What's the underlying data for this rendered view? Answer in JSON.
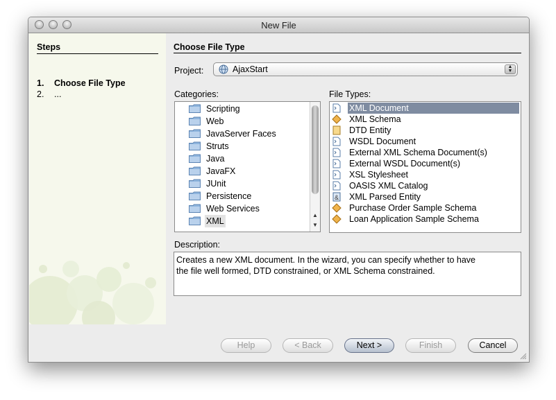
{
  "window": {
    "title": "New File"
  },
  "steps": {
    "header": "Steps",
    "items": [
      {
        "num": "1.",
        "label": "Choose File Type"
      },
      {
        "num": "2.",
        "label": "..."
      }
    ]
  },
  "main": {
    "title": "Choose File Type",
    "project_label": "Project:",
    "project_value": "AjaxStart",
    "categories_label": "Categories:",
    "file_types_label": "File Types:",
    "description_label": "Description:",
    "description_line1": "Creates a new XML document. In the wizard, you can specify whether to have",
    "description_line2": "the file well formed, DTD constrained, or XML Schema constrained."
  },
  "categories": [
    {
      "label": "Scripting"
    },
    {
      "label": "Web"
    },
    {
      "label": "JavaServer Faces"
    },
    {
      "label": "Struts"
    },
    {
      "label": "Java"
    },
    {
      "label": "JavaFX"
    },
    {
      "label": "JUnit"
    },
    {
      "label": "Persistence"
    },
    {
      "label": "Web Services"
    },
    {
      "label": "XML"
    }
  ],
  "file_types": [
    {
      "label": "XML Document",
      "icon": "xml-document-icon"
    },
    {
      "label": "XML Schema",
      "icon": "xml-schema-icon"
    },
    {
      "label": "DTD Entity",
      "icon": "dtd-entity-icon"
    },
    {
      "label": "WSDL Document",
      "icon": "wsdl-document-icon"
    },
    {
      "label": "External XML Schema Document(s)",
      "icon": "document-icon"
    },
    {
      "label": "External WSDL Document(s)",
      "icon": "document-icon"
    },
    {
      "label": "XSL Stylesheet",
      "icon": "xsl-stylesheet-icon"
    },
    {
      "label": "OASIS XML Catalog",
      "icon": "document-icon"
    },
    {
      "label": "XML Parsed Entity",
      "icon": "parsed-entity-icon"
    },
    {
      "label": "Purchase Order Sample Schema",
      "icon": "xml-schema-icon"
    },
    {
      "label": "Loan Application Sample Schema",
      "icon": "xml-schema-icon"
    }
  ],
  "buttons": {
    "help": "Help",
    "back": "< Back",
    "next": "Next >",
    "finish": "Finish",
    "cancel": "Cancel"
  },
  "colors": {
    "selection": "#7f8ca1",
    "steps_panel": "#f6f8ec",
    "folder": "#8fb5dd"
  }
}
